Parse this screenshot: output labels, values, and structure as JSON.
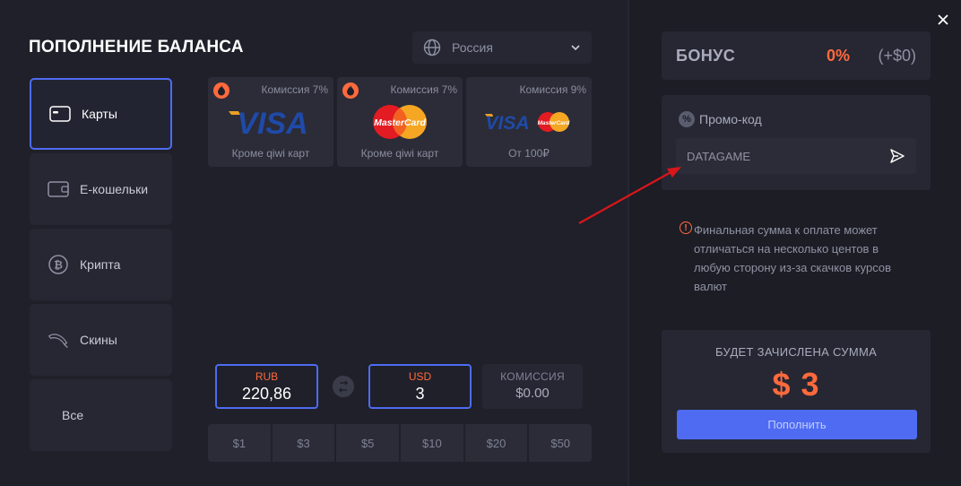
{
  "title": "ПОПОЛНЕНИЕ БАЛАНСА",
  "country": {
    "label": "Россия",
    "icon": "globe-icon"
  },
  "methods": [
    {
      "label": "Карты",
      "icon": "card-icon",
      "active": true
    },
    {
      "label": "Е-кошельки",
      "icon": "wallet-icon",
      "active": false
    },
    {
      "label": "Крипта",
      "icon": "bitcoin-icon",
      "active": false
    },
    {
      "label": "Скины",
      "icon": "knife-icon",
      "active": false
    },
    {
      "label": "Все",
      "active": false
    }
  ],
  "cards": [
    {
      "fee": "Комиссия 7%",
      "brand": "VISA",
      "note": "Кроме qiwi карт",
      "hot": true
    },
    {
      "fee": "Комиссия 7%",
      "brand": "MasterCard",
      "note": "Кроме qiwi карт",
      "hot": true
    },
    {
      "fee": "Комиссия 9%",
      "brand": "VISA + MasterCard",
      "note": "От 100₽",
      "hot": false
    }
  ],
  "mc_text": "MasterCard",
  "visa_text": "VISA",
  "converter": {
    "from": {
      "code": "RUB",
      "amount": "220,86"
    },
    "to": {
      "code": "USD",
      "amount": "3"
    },
    "fee": {
      "label": "КОМИССИЯ",
      "amount": "$0.00"
    }
  },
  "quick_amounts": [
    "$1",
    "$3",
    "$5",
    "$10",
    "$20",
    "$50"
  ],
  "bonus": {
    "label": "БОНУС",
    "percent": "0%",
    "usd": "(+$0)"
  },
  "promo": {
    "label": "Промо-код",
    "value": "DATAGAME",
    "icon_glyph": "%"
  },
  "note": {
    "glyph": "!",
    "text": "Финальная сумма к оплате может отличаться на несколько центов в любую сторону из-за скачков курсов валют"
  },
  "credit": {
    "label": "БУДЕТ ЗАЧИСЛЕНА СУММА",
    "amount": "$ 3",
    "button": "Пополнить"
  },
  "colors": {
    "accent": "#4e6bf2",
    "orange": "#ff6a3d",
    "background": "#1f2029",
    "panel": "#262733"
  }
}
